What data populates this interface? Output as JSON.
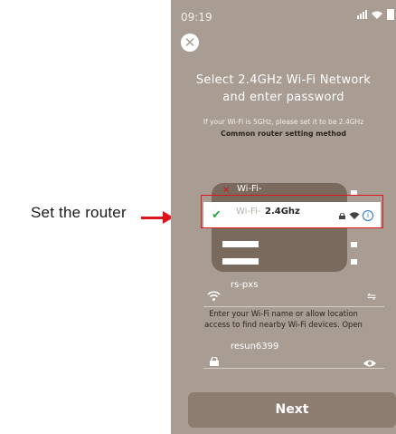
{
  "annotation": {
    "caption": "Set the router"
  },
  "status_bar": {
    "time": "09:19"
  },
  "screen": {
    "title_line1": "Select 2.4GHz Wi-Fi Network",
    "title_line2": "and enter password",
    "hint": "If your Wi-Fi is 5GHz, please set it to be 2.4GHz",
    "hint_link": "Common router setting method"
  },
  "router_illustration": {
    "top_label": "Wi-Fi-",
    "selected_ssid_prefix": "Wi-Fi-",
    "selected_ssid_band": "2.4Ghz"
  },
  "form": {
    "wifi_name": "rs-pxs",
    "enter_message_line1": "Enter your Wi-Fi name or allow location",
    "enter_message_line2": "access to find nearby Wi-Fi devices. Open",
    "password": "resun6399"
  },
  "actions": {
    "next_label": "Next"
  },
  "colors": {
    "background": "#a99d93",
    "router_card": "#7a6a5e",
    "highlight_frame": "#e0121b",
    "check": "#2aa84a",
    "info": "#1f6fd1",
    "next_button": "#8d7d71"
  }
}
